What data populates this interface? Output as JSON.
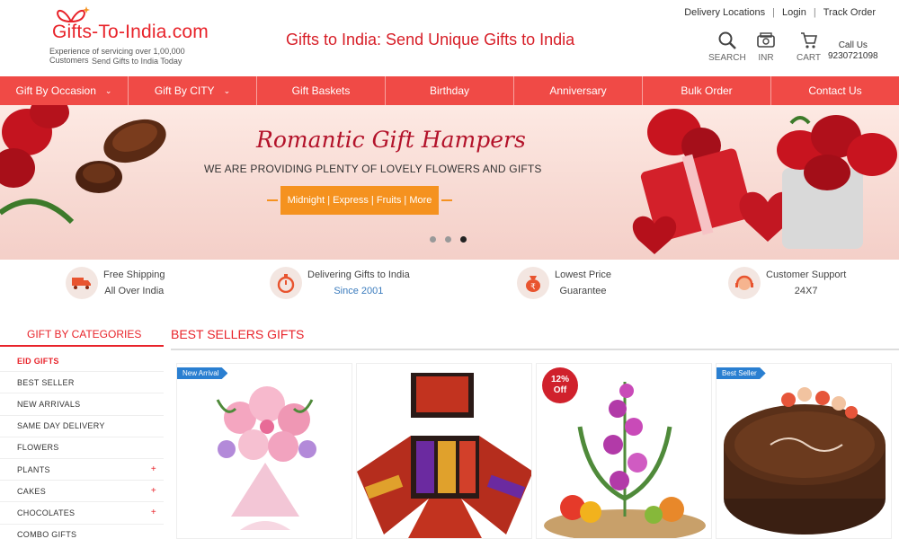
{
  "header": {
    "logo_text": "Gifts-To-India.com",
    "logo_sub1": "Experience of servicing over 1,00,000 Customers",
    "logo_sub2": "Send Gifts to India Today",
    "site_title": "Gifts to India: Send Unique Gifts to India",
    "top_links": [
      "Delivery Locations",
      "Login",
      "Track Order"
    ],
    "icons": [
      {
        "icon": "search-icon",
        "label": "SEARCH"
      },
      {
        "icon": "currency-icon",
        "label": "INR"
      },
      {
        "icon": "cart-icon",
        "label": "CART"
      }
    ],
    "call_us_label": "Call Us",
    "call_us_number": "9230721098"
  },
  "nav": [
    {
      "label": "Gift By Occasion",
      "dropdown": true
    },
    {
      "label": "Gift By CITY",
      "dropdown": true
    },
    {
      "label": "Gift Baskets",
      "dropdown": false
    },
    {
      "label": "Birthday",
      "dropdown": false
    },
    {
      "label": "Anniversary",
      "dropdown": false
    },
    {
      "label": "Bulk Order",
      "dropdown": false
    },
    {
      "label": "Contact Us",
      "dropdown": false
    }
  ],
  "banner": {
    "title": "Romantic Gift Hampers",
    "subtitle": "WE ARE PROVIDING PLENTY OF LOVELY FLOWERS AND GIFTS",
    "button": "Midnight | Express | Fruits | More",
    "slides": 3,
    "active_slide": 3
  },
  "features": [
    {
      "icon": "truck-icon",
      "line1": "Free Shipping",
      "line2": "All Over India"
    },
    {
      "icon": "stopwatch-icon",
      "line1": "Delivering Gifts to India",
      "line2": "Since 2001"
    },
    {
      "icon": "money-bag-icon",
      "line1": "Lowest Price",
      "line2": "Guarantee"
    },
    {
      "icon": "support-icon",
      "line1": "Customer Support",
      "line2": "24X7"
    }
  ],
  "sidebar": {
    "heading": "GIFT BY CATEGORIES",
    "items": [
      {
        "label": "EID GIFTS",
        "active": true,
        "expandable": false
      },
      {
        "label": "BEST SELLER",
        "active": false,
        "expandable": false
      },
      {
        "label": "NEW ARRIVALS",
        "active": false,
        "expandable": false
      },
      {
        "label": "SAME DAY DELIVERY",
        "active": false,
        "expandable": false
      },
      {
        "label": "FLOWERS",
        "active": false,
        "expandable": false
      },
      {
        "label": "PLANTS",
        "active": false,
        "expandable": true
      },
      {
        "label": "CAKES",
        "active": false,
        "expandable": true
      },
      {
        "label": "CHOCOLATES",
        "active": false,
        "expandable": true
      },
      {
        "label": "COMBO GIFTS",
        "active": false,
        "expandable": false
      }
    ]
  },
  "best_sellers": {
    "heading": "BEST SELLERS GIFTS",
    "products": [
      {
        "name": "pink-lilies-bouquet",
        "badge": "New Arrival",
        "badge_type": "tag"
      },
      {
        "name": "chocolate-explosion-box",
        "badge": "",
        "badge_type": "none"
      },
      {
        "name": "orchid-fruit-basket",
        "badge": "12% Off",
        "badge_type": "circle"
      },
      {
        "name": "chocolate-birthday-cake",
        "badge": "Best Seller",
        "badge_type": "tag"
      }
    ]
  },
  "colors": {
    "brand_red": "#e8232a",
    "nav_bg": "#f04a46",
    "banner_button": "#f5921f",
    "badge_blue": "#2a7fd1",
    "accent_blue": "#3a7bbd"
  }
}
